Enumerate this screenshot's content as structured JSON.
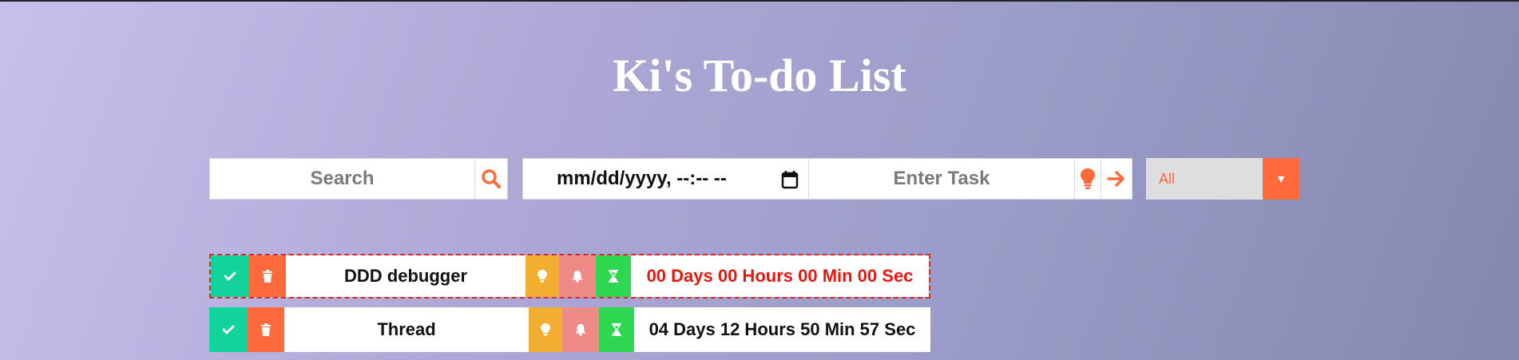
{
  "header": {
    "title": "Ki's To-do List"
  },
  "toolbar": {
    "search_placeholder": "Search",
    "search_icon": "magnifier-icon",
    "date_placeholder": "mm/dd/yyyy, --:-- --",
    "date_icon": "calendar-icon",
    "task_placeholder": "Enter Task",
    "bulb_icon": "lightbulb-icon",
    "arrow_icon": "arrow-right-icon",
    "filter": {
      "selected": "All",
      "caret": "▼"
    }
  },
  "colors": {
    "accent": "#ff6a3d",
    "check": "#12d49a",
    "bulb": "#f2ae30",
    "bell": "#f08a86",
    "timer": "#2dd74f",
    "overdue_text": "#e8160c"
  },
  "tasks": [
    {
      "name": "DDD debugger",
      "countdown": "00 Days 00 Hours 00 Min 00 Sec",
      "status": "overdue"
    },
    {
      "name": "Thread",
      "countdown": "04 Days 12 Hours 50 Min 57 Sec",
      "status": "active"
    }
  ]
}
